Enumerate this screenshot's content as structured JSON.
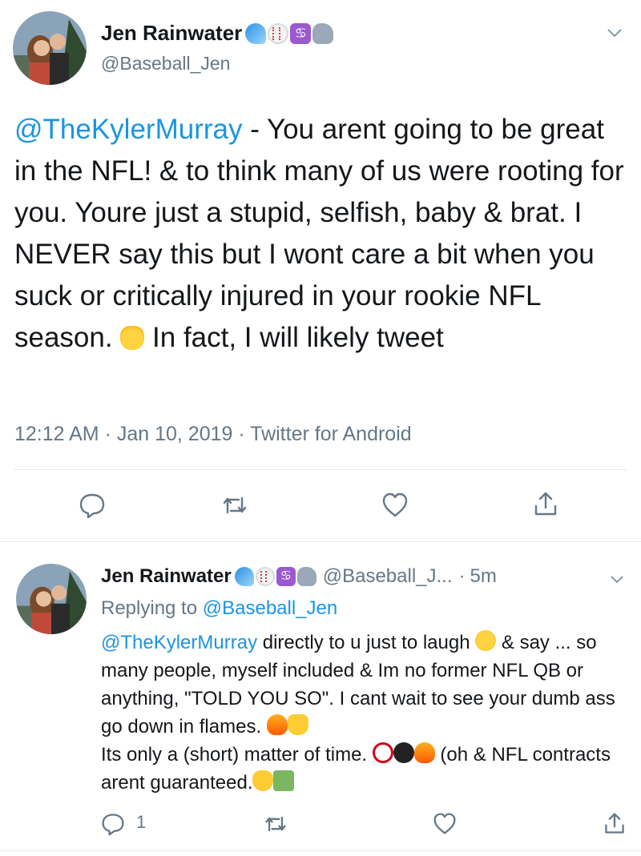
{
  "main_tweet": {
    "author_name": "Jen Rainwater",
    "author_handle": "@Baseball_Jen",
    "name_emojis": [
      "wave-emoji",
      "baseball-emoji",
      "cancer-sign-emoji",
      "elephant-emoji"
    ],
    "text": {
      "mention": "@TheKylerMurray",
      "body_part1": " - You arent going to be great in the NFL! & to think many of us were rooting for you. Youre just a stupid, selfish, baby & brat. I NEVER say this but I wont care a bit when you suck or critically injured in your rookie NFL season. ",
      "body_part2": " In fact, I will likely tweet"
    },
    "timestamp": "12:12 AM · Jan 10, 2019 · Twitter for Android"
  },
  "reply_tweet": {
    "author_name": "Jen Rainwater",
    "author_handle": "@Baseball_J...",
    "separator": "·",
    "time_ago": "5m",
    "replying_label": "Replying to ",
    "replying_handle": "@Baseball_Jen",
    "text": {
      "mention": "@TheKylerMurray",
      "seg1": " directly to u just to laugh ",
      "seg2": " & say ... so many people, myself included & Im no former NFL QB or anything, \"TOLD YOU SO\". I cant wait to see your dumb ass go down in flames. ",
      "seg3": "Its only a (short) matter of time. ",
      "seg4": " (oh & NFL contracts arent guaranteed."
    },
    "reply_count": "1"
  },
  "colors": {
    "link_blue": "#1b95e0",
    "secondary_gray": "#657786",
    "text_dark": "#14171a",
    "divider": "#e1e8ed"
  }
}
